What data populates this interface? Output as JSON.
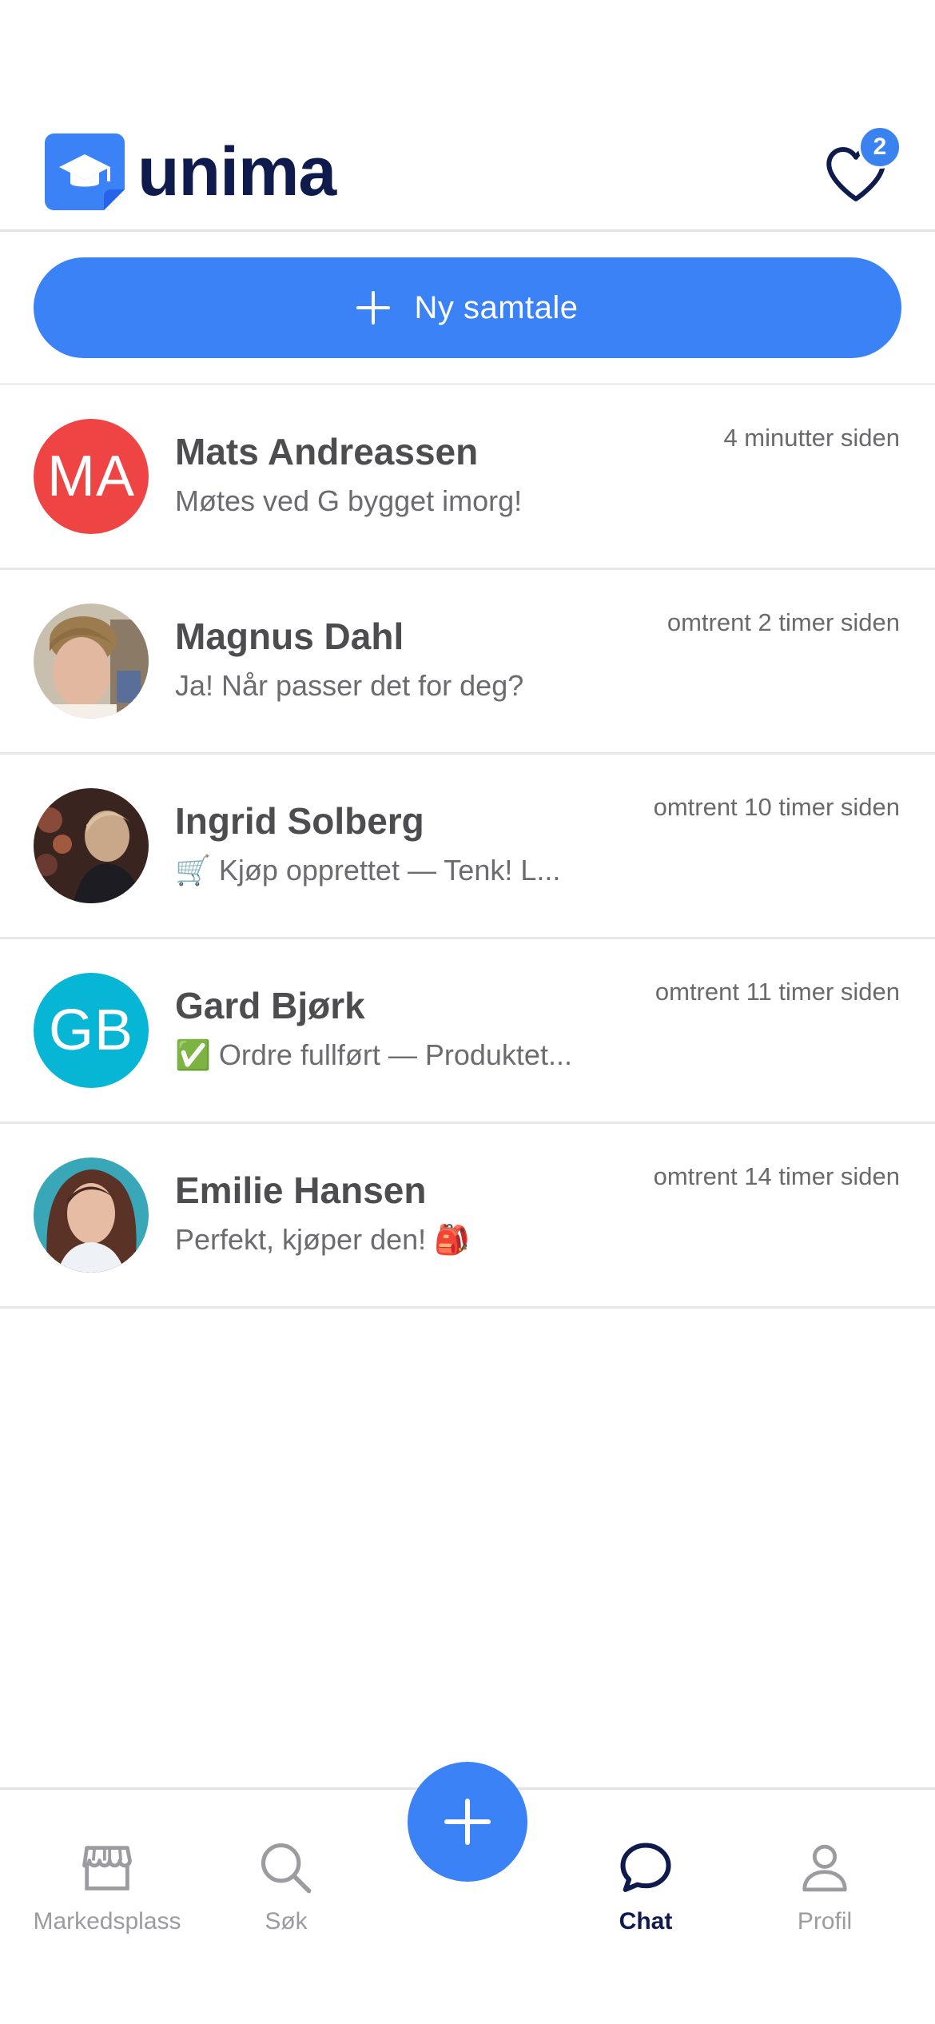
{
  "app": {
    "name": "unima"
  },
  "header": {
    "favorites_count": "2"
  },
  "new_chat": {
    "label": "Ny samtale"
  },
  "conversations": [
    {
      "name": "Mats Andreassen",
      "time": "4 minutter siden",
      "preview": "Møtes ved G bygget imorg!",
      "initials": "MA",
      "avatar_color": "#ef4444",
      "emoji": ""
    },
    {
      "name": "Magnus Dahl",
      "time": "omtrent 2 timer siden",
      "preview": "Ja! Når passer det for deg?",
      "initials": "",
      "avatar_color": "#b9a88e",
      "emoji": ""
    },
    {
      "name": "Ingrid Solberg",
      "time": "omtrent 10 timer siden",
      "preview": "Kjøp opprettet — Tenk! L...",
      "initials": "",
      "avatar_color": "#5a3a2e",
      "emoji": "🛒"
    },
    {
      "name": "Gard Bjørk",
      "time": "omtrent 11 timer siden",
      "preview": "Ordre fullført — Produktet...",
      "initials": "GB",
      "avatar_color": "#06b6d4",
      "emoji": "✅"
    },
    {
      "name": "Emilie Hansen",
      "time": "omtrent 14 timer siden",
      "preview": "Perfekt, kjøper den! 🎒",
      "initials": "",
      "avatar_color": "#7a5a55",
      "emoji": ""
    }
  ],
  "tabs": [
    {
      "label": "Markedsplass",
      "icon": "storefront-icon"
    },
    {
      "label": "Søk",
      "icon": "search-icon"
    },
    {
      "label": "Chat",
      "icon": "chat-bubble-icon",
      "active": true
    },
    {
      "label": "Profil",
      "icon": "person-icon"
    }
  ],
  "colors": {
    "accent": "#3b82f6",
    "brand_navy": "#0f1a4d"
  }
}
